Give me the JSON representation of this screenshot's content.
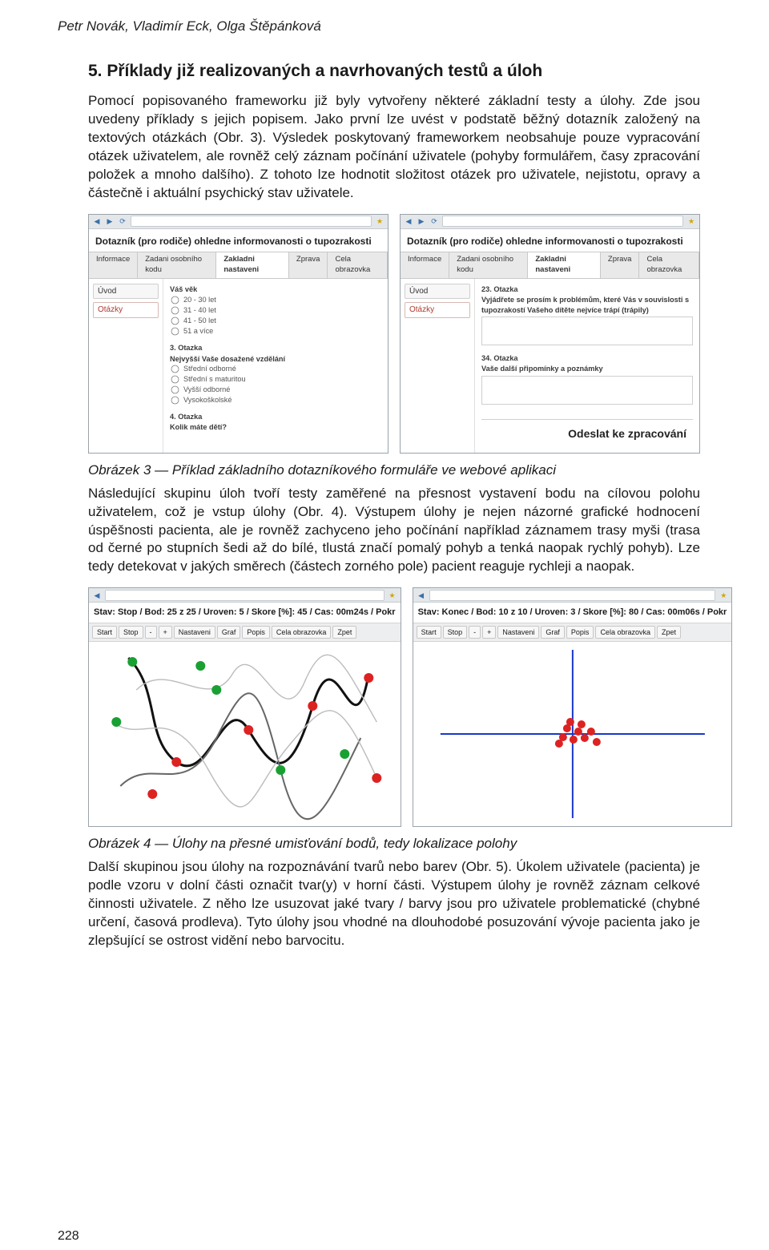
{
  "running_head": "Petr Novák, Vladimír Eck, Olga Štěpánková",
  "heading": "5.  Příklady již realizovaných a navrhovaných testů a úloh",
  "para1": "Pomocí popisovaného frameworku již byly vytvořeny některé základní testy a úlohy. Zde jsou uvedeny příklady s jejich popisem. Jako první lze uvést v podstatě běžný dotazník založený na textových otázkách (Obr. 3). Výsledek poskytovaný frameworkem neobsahuje pouze vypracování otázek uživatelem, ale rovněž celý záznam počínání uživatele (pohyby formulářem, časy zpracování položek a mnoho dalšího). Z tohoto lze hodnotit složitost otázek pro uživatele, nejistotu, opravy a částečně i aktuální psychický stav uživatele.",
  "fig3_caption": "Obrázek 3 — Příklad základního dotazníkového formuláře ve webové aplikaci",
  "para2": "Následující skupinu úloh tvoří testy zaměřené na přesnost vystavení bodu na cílovou polohu uživatelem, což je vstup úlohy (Obr. 4). Výstupem úlohy je nejen názorné grafické hodnocení úspěšnosti pacienta, ale je rovněž zachyceno jeho počínání například záznamem trasy myši (trasa od černé po stupních šedi až do bílé, tlustá značí pomalý pohyb a tenká naopak rychlý pohyb). Lze tedy detekovat v jakých směrech (částech zorného pole) pacient reaguje rychleji a naopak.",
  "fig4_caption": "Obrázek 4 — Úlohy na přesné umisťování bodů, tedy lokalizace polohy",
  "para3": "Další skupinou jsou úlohy na rozpoznávání tvarů nebo barev (Obr. 5). Úkolem uživatele (pacienta) je podle vzoru v dolní části označit tvar(y) v horní části. Výstupem úlohy je rovněž záznam celkové činnosti uživatele. Z něho lze usuzovat jaké tvary / barvy jsou pro uživatele problematické (chybné určení, časová prodleva). Tyto úlohy jsou vhodné na dlouhodobé posuzování vývoje pacienta jako je zlepšující se ostrost vidění nebo barvocitu.",
  "page_number": "228",
  "form": {
    "title": "Dotazník (pro rodiče) ohledne informovanosti o tupozrakosti",
    "tabs": [
      "Informace",
      "Zadani osobního kodu",
      "Zakladni nastaveni",
      "Zprava",
      "Cela obrazovka"
    ],
    "side_intro": "Úvod",
    "side_questions": "Otázky",
    "left": {
      "q_age_head": "Váš věk",
      "q_age_opts": [
        "20 - 30 let",
        "31 - 40 let",
        "41 - 50 let",
        "51 a více"
      ],
      "q3_head": "3. Otazka",
      "q3_sub": "Nejvyšší Vaše dosažené vzdělání",
      "q3_opts": [
        "Střední odborné",
        "Střední s maturitou",
        "Vyšší odborné",
        "Vysokoškolské"
      ],
      "q4_head": "4. Otazka",
      "q4_sub": "Kolik máte dětí?"
    },
    "right": {
      "q23_head": "23. Otazka",
      "q23_sub": "Vyjádřete se prosím k problémům, které Vás v souvislosti s tupozrakostí Vašeho dítěte nejvíce trápí (trápily)",
      "q34_head": "34. Otazka",
      "q34_sub": "Vaše další připomínky a poznámky",
      "send": "Odeslat ke zpracování"
    }
  },
  "game": {
    "left_status": "Stav: Stop / Bod: 25 z 25 / Uroven: 5 / Skore [%]: 45 / Cas: 00m24s / Pokr",
    "right_status": "Stav: Konec / Bod: 10 z 10 / Uroven: 3 / Skore [%]: 80 / Cas: 00m06s / Pokr",
    "buttons": [
      "Start",
      "Stop",
      "-",
      "+",
      "Nastaveni",
      "Graf",
      "Popis",
      "Cela obrazovka",
      "Zpet"
    ]
  }
}
